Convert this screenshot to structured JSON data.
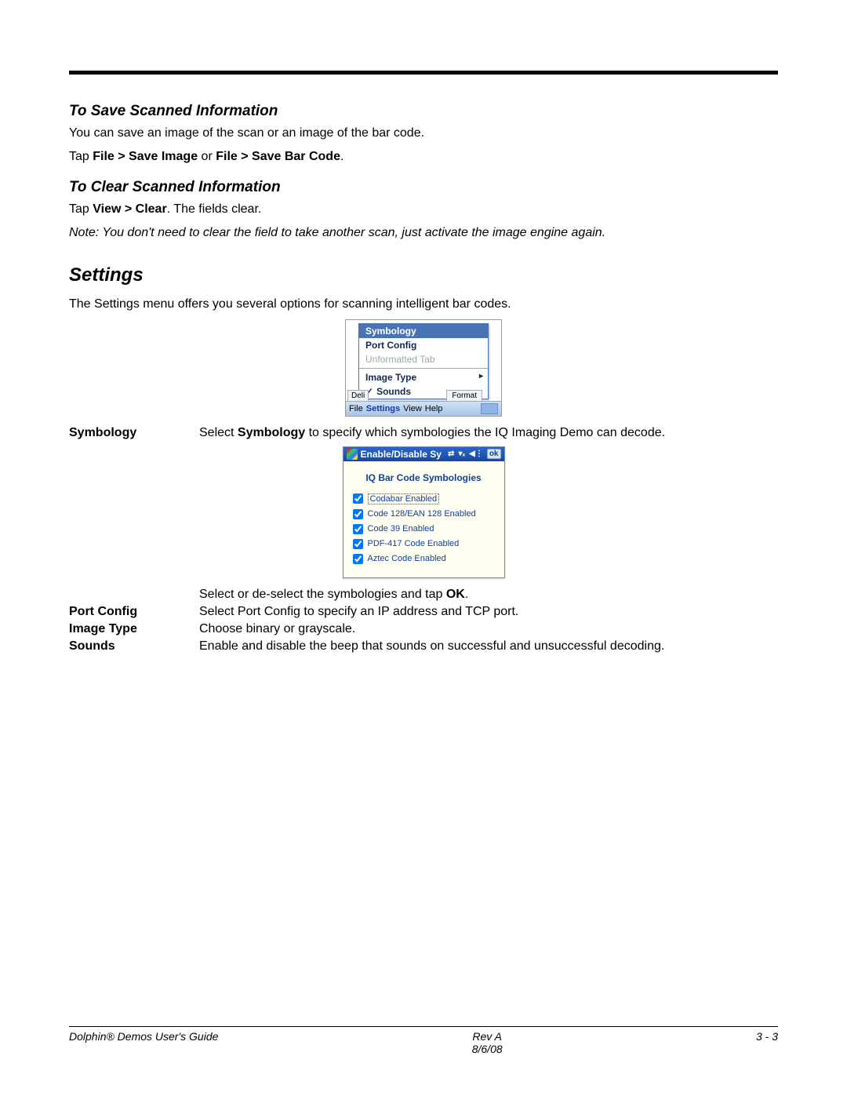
{
  "section1": {
    "heading": "To Save Scanned Information",
    "p1": "You can save an image of the scan or an image of the bar code.",
    "p2_pre": "Tap ",
    "p2_bold": "File > Save Image",
    "p2_mid": " or ",
    "p2_bold2": "File > Save Bar Code",
    "p2_end": "."
  },
  "section2": {
    "heading": "To Clear Scanned Information",
    "p1_pre": "Tap ",
    "p1_bold": "View > Clear",
    "p1_end": ". The fields clear.",
    "note": "Note: You don't need to clear the field to take another scan, just activate the image engine again."
  },
  "settings": {
    "heading": "Settings",
    "intro": "The Settings menu offers you several options for scanning intelligent bar codes.",
    "menu": {
      "items": [
        "Symbology",
        "Port Config",
        "Unformatted Tab",
        "Image Type",
        "Sounds"
      ],
      "rear_tab1": "Deli",
      "rear_tab2": "Format",
      "bar": [
        "File",
        "Settings",
        "View",
        "Help"
      ]
    },
    "rows": [
      {
        "label": "Symbology",
        "desc_pre": "Select ",
        "desc_bold": "Symbology",
        "desc_post": " to specify which symbologies the IQ Imaging Demo can decode."
      },
      {
        "label": "",
        "desc_pre": "Select or de-select the symbologies and tap ",
        "desc_bold": "OK",
        "desc_post": "."
      },
      {
        "label": "Port Config",
        "desc": "Select Port Config to specify an IP address and TCP port."
      },
      {
        "label": "Image Type",
        "desc": "Choose binary or grayscale."
      },
      {
        "label": "Sounds",
        "desc": "Enable and disable the beep that sounds on successful and unsuccessful decoding."
      }
    ],
    "dialog": {
      "titlebar": "Enable/Disable Sy",
      "ok": "ok",
      "header": "IQ Bar Code Symbologies",
      "items": [
        "Codabar Enabled",
        "Code 128/EAN 128 Enabled",
        "Code 39 Enabled",
        "PDF-417 Code Enabled",
        "Aztec Code Enabled"
      ]
    }
  },
  "footer": {
    "left": "Dolphin® Demos User's Guide",
    "mid1": "Rev A",
    "mid2": "8/6/08",
    "right": "3 - 3"
  }
}
